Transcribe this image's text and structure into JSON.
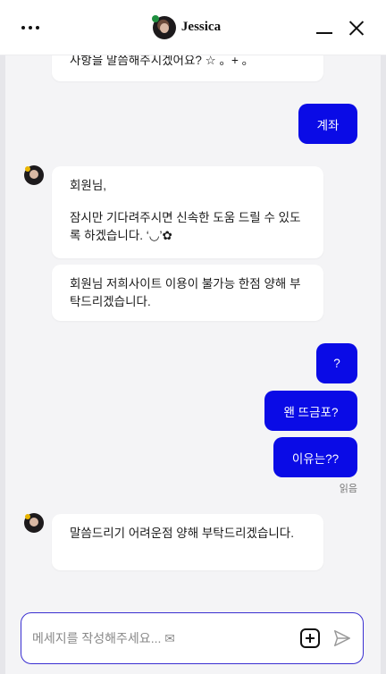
{
  "header": {
    "title": "Jessica",
    "icons": {
      "more": "more-horizontal-icon",
      "minimize": "minimize-icon",
      "close": "close-icon"
    }
  },
  "messages": [
    {
      "role": "bot",
      "text": "사항을 말씀해주시겠어요? ☆ 。+ 。"
    },
    {
      "role": "user",
      "text": "계좌"
    },
    {
      "role": "bot",
      "line1": "회원님,",
      "line2": "잠시만 기다려주시면 신속한 도움 드릴 수 있도록 하겠습니다. ‘◡’✿"
    },
    {
      "role": "bot",
      "text": "회원님 저희사이트 이용이 불가능 한점 양해 부탁드리겠습니다."
    },
    {
      "role": "user",
      "text": "?"
    },
    {
      "role": "user",
      "text": "왠 뜨금포?"
    },
    {
      "role": "user",
      "text": "이유는??"
    },
    {
      "role": "bot",
      "text": "말씀드리기 어려운점 양해 부탁드리겠습니다."
    }
  ],
  "read_receipt": "읽음",
  "composer": {
    "placeholder": "메세지를 작성해주세요... ✉"
  },
  "colors": {
    "accent": "#0a0be6",
    "border": "#3a2fd1",
    "background": "#f4f4f6"
  }
}
